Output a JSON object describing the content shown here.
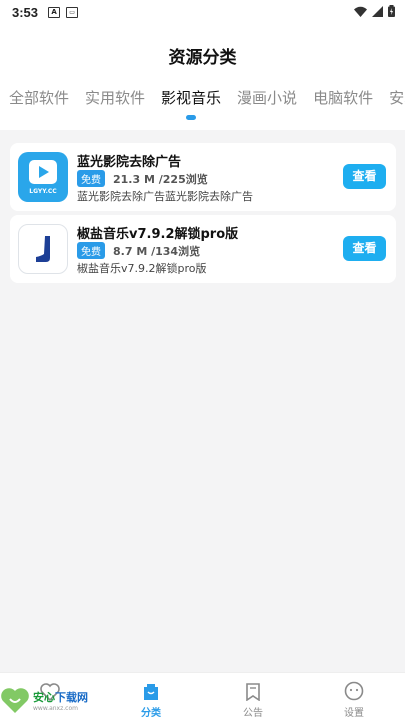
{
  "status": {
    "time": "3:53"
  },
  "header": {
    "title": "资源分类"
  },
  "tabs": [
    {
      "label": "全部软件",
      "active": false
    },
    {
      "label": "实用软件",
      "active": false
    },
    {
      "label": "影视音乐",
      "active": true
    },
    {
      "label": "漫画小说",
      "active": false
    },
    {
      "label": "电脑软件",
      "active": false
    },
    {
      "label": "安卓",
      "active": false
    }
  ],
  "apps": [
    {
      "name": "蓝光影院去除广告",
      "badge": "免费",
      "stats": "21.3 M /225浏览",
      "description": "蓝光影院去除广告蓝光影院去除广告",
      "icon_text": "LGYY.CC",
      "button": "查看"
    },
    {
      "name": "椒盐音乐v7.9.2解锁pro版",
      "badge": "免费",
      "stats": "8.7 M /134浏览",
      "description": "椒盐音乐v7.9.2解锁pro版",
      "button": "查看"
    }
  ],
  "bottom_nav": [
    {
      "label": "",
      "icon": "heart-icon",
      "active": false
    },
    {
      "label": "分类",
      "icon": "category-icon",
      "active": true
    },
    {
      "label": "公告",
      "icon": "bookmark-icon",
      "active": false
    },
    {
      "label": "设置",
      "icon": "smile-icon",
      "active": false
    }
  ],
  "watermark": {
    "title_green": "安心",
    "title_blue": "下载网",
    "url": "www.anxz.com"
  },
  "colors": {
    "accent": "#2a9be8",
    "button": "#1eaef0"
  }
}
